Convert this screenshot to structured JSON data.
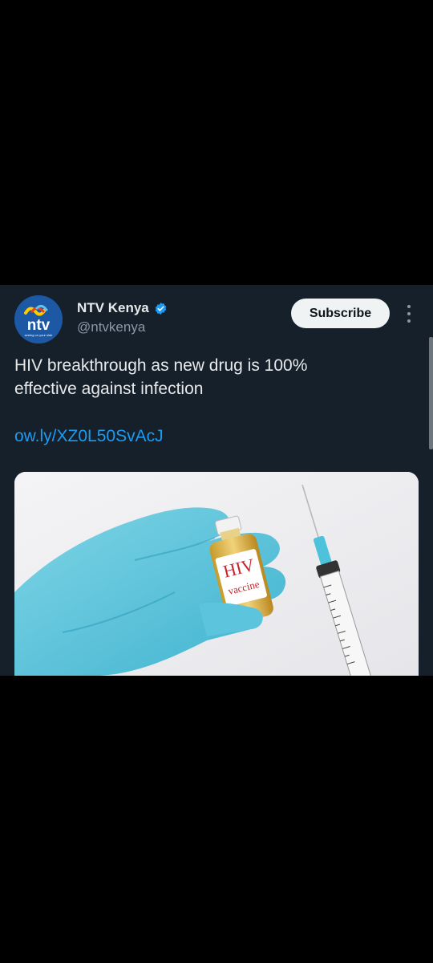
{
  "tweet": {
    "display_name": "NTV Kenya",
    "handle": "@ntvkenya",
    "subscribe_label": "Subscribe",
    "text_line1": "HIV breakthrough as new drug is 100%",
    "text_line2": "effective against infection",
    "link": "ow.ly/XZ0L50SvAcJ"
  },
  "avatar": {
    "logo_text": "ntv",
    "tagline": "seeing on your side"
  },
  "media": {
    "vial_label_1": "HIV",
    "vial_label_2": "vaccine"
  },
  "colors": {
    "background": "#000000",
    "card": "#15202b",
    "link": "#1d9bf0",
    "verified": "#1d9bf0"
  }
}
